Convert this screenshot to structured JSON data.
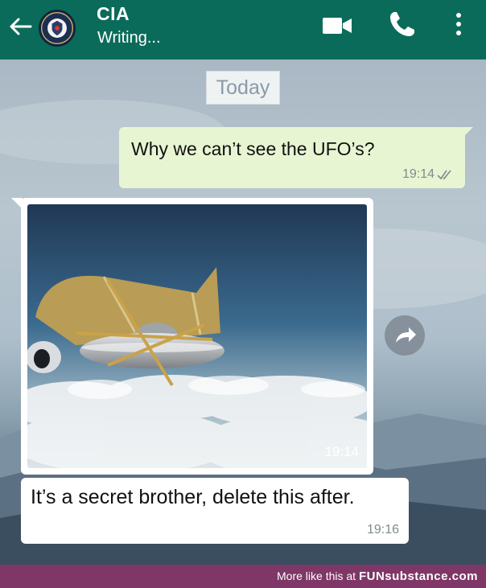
{
  "header": {
    "contact_name": "CIA",
    "status": "Writing...",
    "icons": {
      "back": "back-arrow-icon",
      "video": "video-call-icon",
      "phone": "phone-call-icon",
      "menu": "more-vert-icon"
    }
  },
  "chat": {
    "date_chip": "Today",
    "messages": [
      {
        "direction": "outgoing",
        "text": "Why we can’t see the UFO’s?",
        "time": "19:14",
        "status": "read"
      },
      {
        "direction": "incoming",
        "type": "image",
        "time": "19:14"
      },
      {
        "direction": "incoming",
        "text": "It’s a secret brother, delete this after.",
        "time": "19:16"
      }
    ]
  },
  "footer": {
    "prefix": "More like this at ",
    "brand": "FUNsubstance.com"
  },
  "colors": {
    "header": "#0b6b5a",
    "outgoing_bubble": "#e8f5d3",
    "incoming_bubble": "#ffffff",
    "footer": "#7e3767"
  }
}
